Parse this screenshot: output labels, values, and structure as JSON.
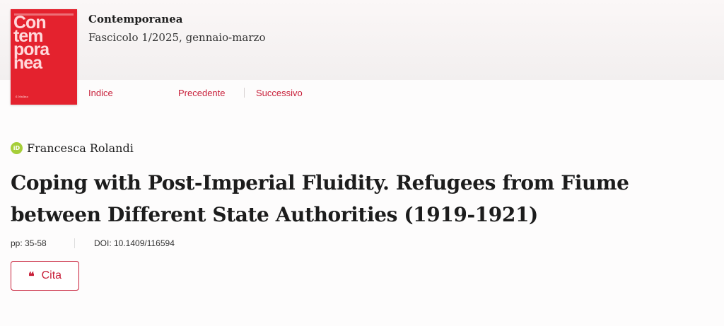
{
  "journal": {
    "title": "Contemporanea",
    "issue": "Fascicolo 1/2025, gennaio-marzo",
    "cover": {
      "word_lines": [
        "Con",
        "tem",
        "pora",
        "nea"
      ],
      "publisher": "il Mulino",
      "color": "#e4222e"
    }
  },
  "nav": {
    "index": "Indice",
    "previous": "Precedente",
    "next": "Successivo"
  },
  "article": {
    "author": "Francesca Rolandi",
    "author_icon": "orcid-icon",
    "title": "Coping with Post-Imperial Fluidity. Refugees from Fiume between Different State Authorities (1919-1921)",
    "pages": "pp: 35-58",
    "doi": "DOI: 10.1409/116594"
  },
  "actions": {
    "cite_label": "Cita",
    "cite_icon": "quote-icon"
  },
  "colors": {
    "accent": "#c8203a",
    "orcid": "#a6ce39"
  }
}
